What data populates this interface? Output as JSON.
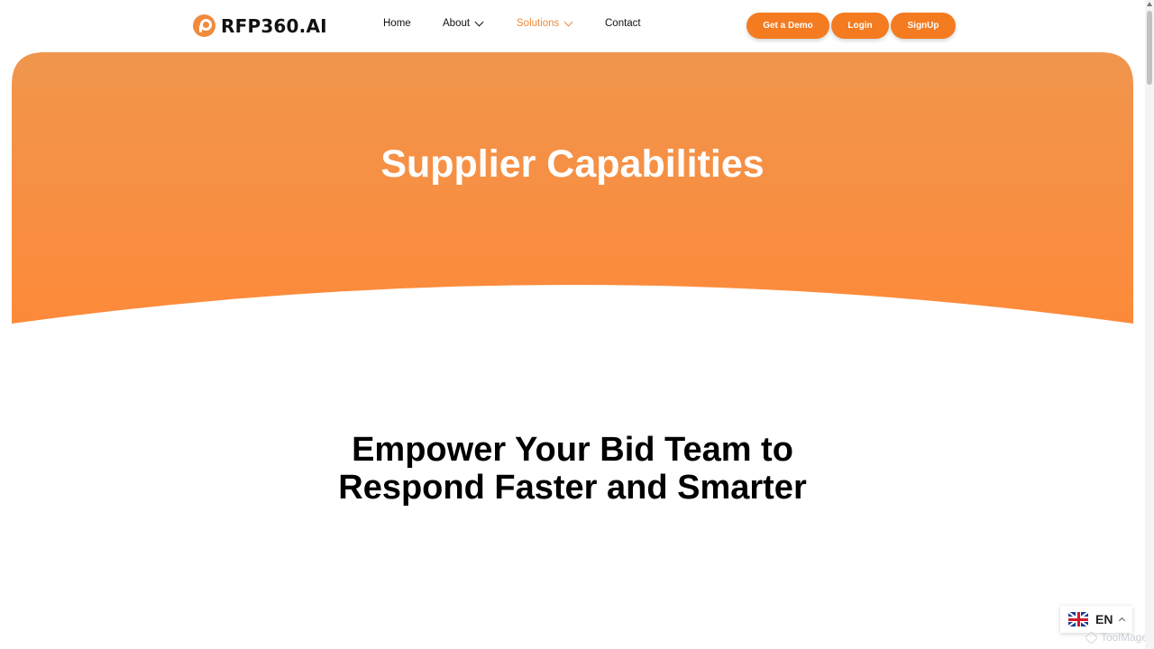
{
  "brand": {
    "name": "RFP360.AI",
    "logo_icon": "rfp360-logo-icon",
    "accent": "#f08a3c"
  },
  "nav": {
    "items": [
      {
        "label": "Home"
      },
      {
        "label": "About",
        "has_dropdown": true
      },
      {
        "label": "Solutions",
        "has_dropdown": true,
        "active": true
      },
      {
        "label": "Contact"
      }
    ],
    "actions": {
      "demo": "Get a Demo",
      "login": "Login",
      "signup": "SignUp"
    }
  },
  "hero": {
    "title": "Supplier Capabilities",
    "gradient": [
      "#f0954d",
      "#fd8a3a"
    ]
  },
  "headline": {
    "line1": "Empower Your Bid Team to",
    "line2": "Respond Faster and Smarter"
  },
  "language": {
    "code": "EN",
    "flag": "uk-flag-icon"
  },
  "watermark": {
    "text": "ToolMage"
  }
}
